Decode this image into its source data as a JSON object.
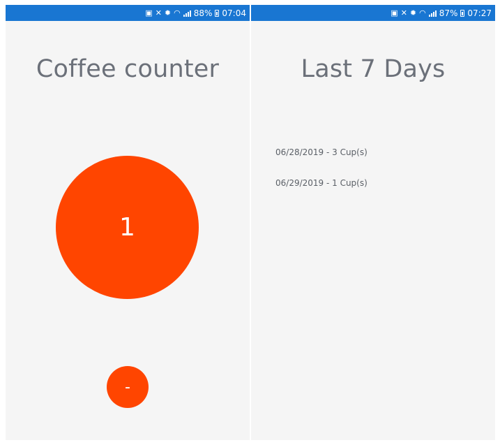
{
  "left_screen": {
    "status_bar": {
      "battery_percent": "88%",
      "time": "07:04"
    },
    "title": "Coffee counter",
    "counter_value": "1",
    "minus_label": "-"
  },
  "right_screen": {
    "status_bar": {
      "battery_percent": "87%",
      "time": "07:27"
    },
    "title": "Last 7 Days",
    "history": [
      "06/28/2019 - 3 Cup(s)",
      "06/29/2019 - 1 Cup(s)"
    ]
  },
  "colors": {
    "status_bar": "#1976d2",
    "accent": "#ff4500",
    "background": "#f5f5f5",
    "title_text": "#6b7079"
  },
  "icons": [
    "battery-saver-icon",
    "mute-icon",
    "settings-icon",
    "wifi-icon",
    "signal-icon",
    "battery-icon"
  ]
}
